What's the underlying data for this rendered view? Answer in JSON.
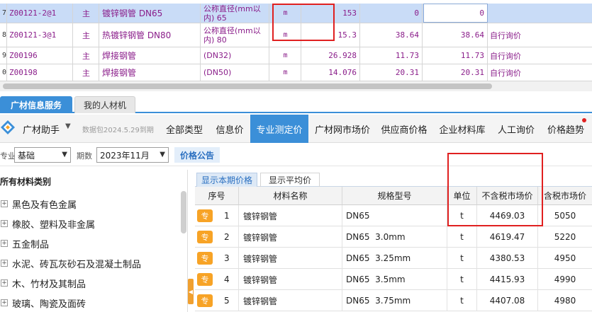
{
  "top_grid": {
    "rows": [
      {
        "no": "7",
        "code": "Z00121-2@1",
        "type": "主",
        "name": "镀锌钢管 DN65",
        "spec": "公称直径(mm以内) 65",
        "unit": "m",
        "qty": "153",
        "price1": "0",
        "price2": "0",
        "source": ""
      },
      {
        "no": "8",
        "code": "Z00121-3@1",
        "type": "主",
        "name": "热镀锌钢管 DN80",
        "spec": "公称直径(mm以内) 80",
        "unit": "m",
        "qty": "15.3",
        "price1": "38.64",
        "price2": "38.64",
        "source": "自行询价"
      },
      {
        "no": "9",
        "code": "Z00196",
        "type": "主",
        "name": "焊接钢管",
        "spec": "(DN32)",
        "unit": "m",
        "qty": "26.928",
        "price1": "11.73",
        "price2": "11.73",
        "source": "自行询价"
      },
      {
        "no": "0",
        "code": "Z00198",
        "type": "主",
        "name": "焊接钢管",
        "spec": "(DN50)",
        "unit": "m",
        "qty": "14.076",
        "price1": "20.31",
        "price2": "20.31",
        "source": "自行询价"
      }
    ]
  },
  "panel_tabs": [
    "广材信息服务",
    "我的人材机"
  ],
  "assistant": {
    "title": "广材助手",
    "caret": "▼",
    "version": "数据包2024.5.29到期",
    "nav": [
      "全部类型",
      "信息价",
      "专业测定价",
      "广材网市场价",
      "供应商价格",
      "企业材料库",
      "人工询价",
      "价格趋势"
    ],
    "active_nav": "专业测定价"
  },
  "filters": {
    "major_label": "专业",
    "major_value": "基础",
    "period_label": "期数",
    "period_value": "2023年11月",
    "notice_button": "价格公告"
  },
  "tree": {
    "header": "所有材料类别",
    "items": [
      "黑色及有色金属",
      "橡胶、塑料及非金属",
      "五金制品",
      "水泥、砖瓦灰砂石及混凝土制品",
      "木、竹材及其制品",
      "玻璃、陶瓷及面砖"
    ]
  },
  "price_table": {
    "subtabs": [
      "显示本期价格",
      "显示平均价"
    ],
    "headers": [
      "序号",
      "材料名称",
      "规格型号",
      "单位",
      "不含税市场价",
      "含税市场价"
    ],
    "tag": "专",
    "rows": [
      {
        "no": "1",
        "name": "镀锌钢管",
        "spec": "DN65",
        "unit": "t",
        "price_ex": "4469.03",
        "price_in": "5050"
      },
      {
        "no": "2",
        "name": "镀锌钢管",
        "spec": "DN65  3.0mm",
        "unit": "t",
        "price_ex": "4619.47",
        "price_in": "5220"
      },
      {
        "no": "3",
        "name": "镀锌钢管",
        "spec": "DN65  3.25mm",
        "unit": "t",
        "price_ex": "4380.53",
        "price_in": "4950"
      },
      {
        "no": "4",
        "name": "镀锌钢管",
        "spec": "DN65  3.5mm",
        "unit": "t",
        "price_ex": "4415.93",
        "price_in": "4990"
      },
      {
        "no": "5",
        "name": "镀锌钢管",
        "spec": "DN65  3.75mm",
        "unit": "t",
        "price_ex": "4407.08",
        "price_in": "4980"
      }
    ]
  },
  "colors": {
    "accent": "#3b8fd8",
    "highlight_box": "#e02020",
    "tag": "#f7a326",
    "row_text": "#8a1d8a"
  }
}
